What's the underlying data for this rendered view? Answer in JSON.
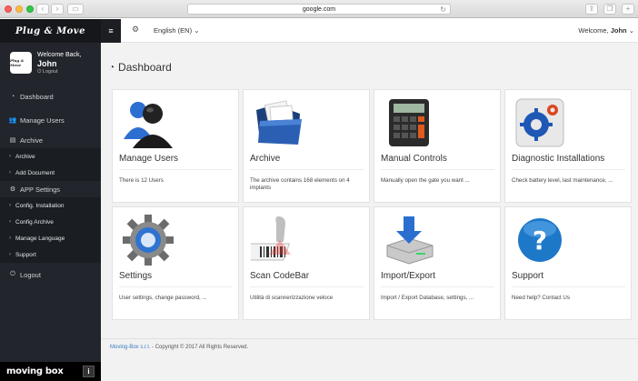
{
  "browser": {
    "url": "google.com",
    "back_icon": "chevron-left-icon",
    "forward_icon": "chevron-right-icon"
  },
  "sidebar": {
    "brand": "Plug & Move",
    "avatar_text": "Plug & Move",
    "welcome": "Welcome Back,",
    "username": "John",
    "logout_small": "Logout",
    "items": [
      {
        "label": "Dashboard",
        "icon": "dashboard-icon"
      },
      {
        "label": "Manage Users",
        "icon": "users-icon"
      },
      {
        "label": "Archive",
        "icon": "archive-icon"
      }
    ],
    "archive_sub": [
      "Archive",
      "Add Document"
    ],
    "app_settings": "APP Settings",
    "settings_sub": [
      "Config. Installation",
      "Config Archive",
      "Manage Language",
      "Support"
    ],
    "logout": "Logout",
    "footer_logo": "moving box",
    "footer_info": "i"
  },
  "topbar": {
    "language": "English (EN)",
    "welcome": "Welcome,",
    "user": "John"
  },
  "main": {
    "title": "Dashboard",
    "cards": [
      {
        "title": "Manage Users",
        "desc": "There is 12 Users",
        "icon": "users-icon"
      },
      {
        "title": "Archive",
        "desc": "The archive contains 168 elements on 4 implants",
        "icon": "folder-icon"
      },
      {
        "title": "Manual Controls",
        "desc": "Manually open the gate you want ...",
        "icon": "calculator-icon"
      },
      {
        "title": "Diagnostic Installations",
        "desc": "Check battery level, last maintenance, ...",
        "icon": "diagnostic-gear-icon"
      },
      {
        "title": "Settings",
        "desc": "User settings, change password, ...",
        "icon": "gear-icon"
      },
      {
        "title": "Scan CodeBar",
        "desc": "Utilità di scannerizzazione veloce",
        "icon": "barcode-scanner-icon"
      },
      {
        "title": "Import/Export",
        "desc": "Import / Export Database, settings, ...",
        "icon": "database-import-icon"
      },
      {
        "title": "Support",
        "desc": "Need help? Contact Us",
        "icon": "help-icon"
      }
    ],
    "footer_link": "Moving-Box s.r.l.",
    "footer_text": " - Copyright © 2017 All Rights Reserved."
  }
}
